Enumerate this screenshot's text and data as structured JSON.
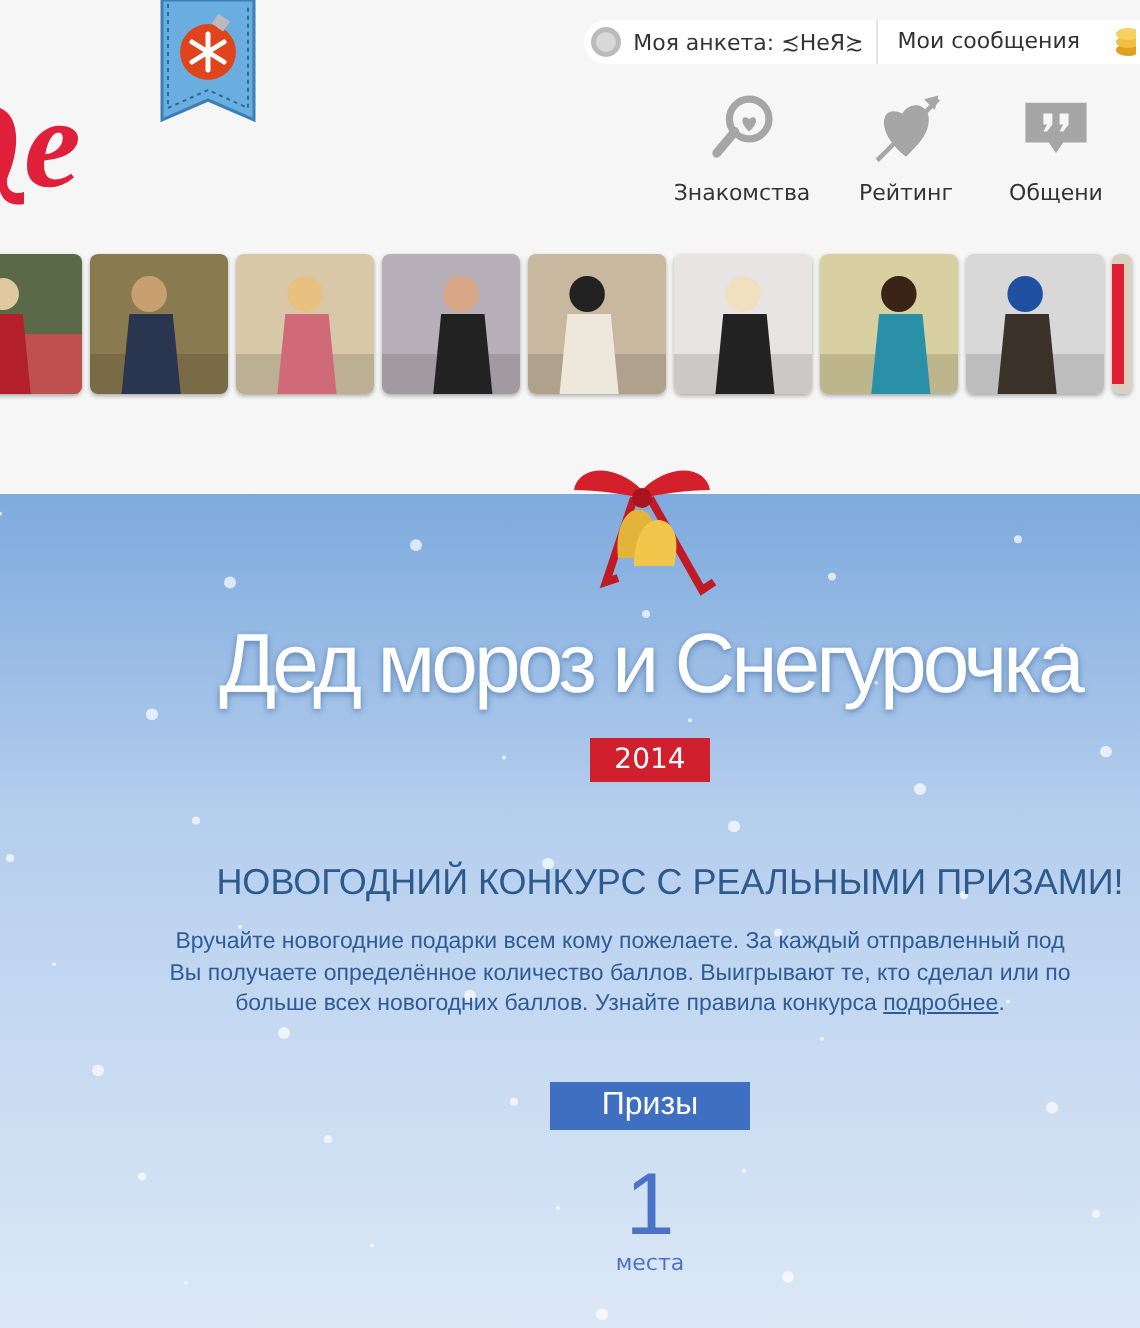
{
  "logo": {
    "text": "e"
  },
  "user_bar": {
    "profile_label": "Моя анкета:",
    "profile_name": "≾НеЯ≿",
    "messages": "Мои сообщения"
  },
  "nav": [
    {
      "label": "Знакомства",
      "kind": "search"
    },
    {
      "label": "Рейтинг",
      "kind": "heart"
    },
    {
      "label": "Общени",
      "kind": "chat"
    }
  ],
  "contest": {
    "title": "Дед мороз и Снегурочка",
    "year": "2014",
    "heading": "НОВОГОДНИЙ КОНКУРС С РЕАЛЬНЫМИ ПРИЗАМИ!",
    "intro_lines": [
      "Вручайте новогодние подарки всем кому пожелаете. За каждый отправленный под",
      "Вы получаете определённое количество баллов. Выигрывают те, кто сделал или по",
      "больше всех новогодних баллов. Узнайте правила конкурса"
    ],
    "intro_link": "подробнее",
    "intro_end": ".",
    "prizes_label": "Призы",
    "place_number": "1",
    "place_label": "места"
  }
}
